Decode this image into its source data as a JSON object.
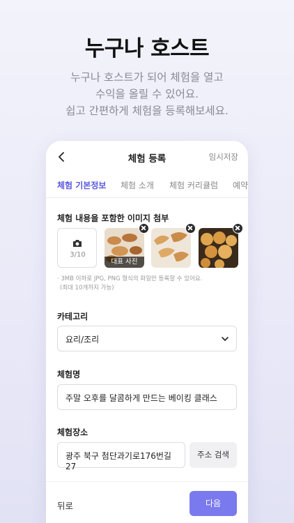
{
  "hero": {
    "title": "누구나 호스트",
    "subtitle_lines": [
      "누구나 호스트가 되어 체험을 열고",
      "수익을 올릴 수 있어요.",
      "쉽고 간편하게 체험을 등록해보세요."
    ]
  },
  "header": {
    "title": "체험 등록",
    "save_draft": "임시저장"
  },
  "tabs": [
    {
      "label": "체험 기본정보",
      "active": true
    },
    {
      "label": "체험 소개",
      "active": false
    },
    {
      "label": "체험 커리큘럼",
      "active": false
    },
    {
      "label": "예약",
      "active": false
    }
  ],
  "images": {
    "label": "체험 내용을 포함한 이미지 첨부",
    "count": "3/10",
    "representative_label": "대표 사진",
    "note_lines": [
      "· 3MB 이하로 JPG, PNG 형식의 파일만 등록할 수 있어요.",
      "(최대 10개까지 가능)"
    ]
  },
  "category": {
    "label": "카테고리",
    "value": "요리/조리"
  },
  "name": {
    "label": "체험명",
    "value": "주말 오후를 달콤하게 만드는 베이킹 클래스"
  },
  "location": {
    "label": "체험장소",
    "value": "광주 북구 첨단과기로176번길 27",
    "search_button": "주소 검색"
  },
  "bottom": {
    "prev": "뒤로",
    "next": "다음"
  },
  "colors": {
    "accent": "#5a58e0",
    "next_button": "#7b79ee"
  }
}
